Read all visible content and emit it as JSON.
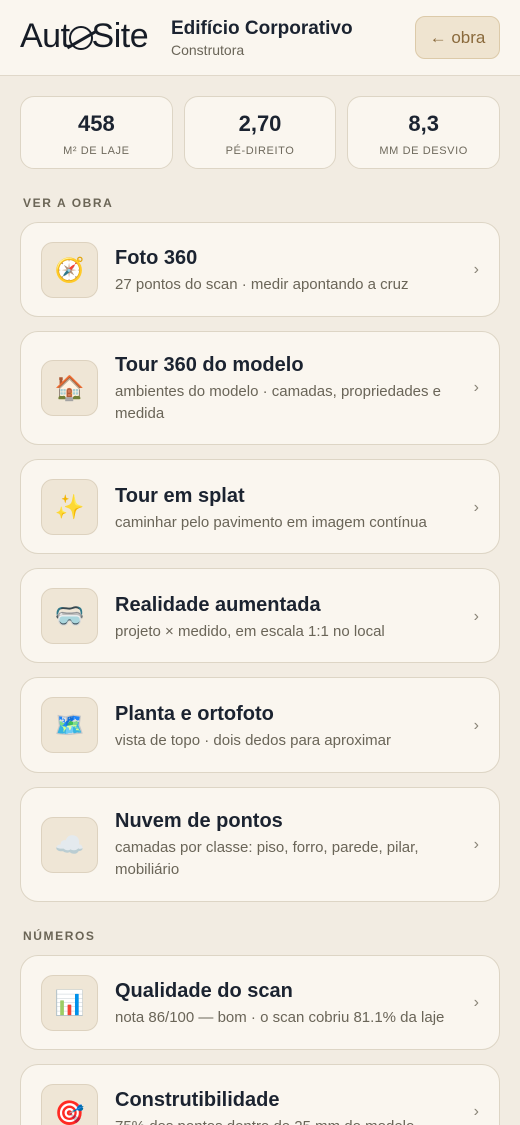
{
  "header": {
    "logo_text_a": "Aut",
    "logo_text_b": "Site",
    "project_title": "Edifício Corporativo",
    "project_subtitle": "Construtora",
    "back_label": "← obra"
  },
  "stats": [
    {
      "value": "458",
      "label": "M² DE LAJE"
    },
    {
      "value": "2,70",
      "label": "PÉ-DIREITO"
    },
    {
      "value": "8,3",
      "label": "MM DE DESVIO"
    }
  ],
  "sections": {
    "view_label": "VER A OBRA",
    "numbers_label": "NÚMEROS"
  },
  "view_cards": [
    {
      "icon": "compass-icon",
      "glyph": "🧭",
      "title": "Foto 360",
      "desc": "27 pontos do scan · medir apontando a cruz"
    },
    {
      "icon": "house-icon",
      "glyph": "🏠",
      "title": "Tour 360 do modelo",
      "desc": "ambientes do modelo · camadas, propriedades e medida"
    },
    {
      "icon": "sparkles-icon",
      "glyph": "✨",
      "title": "Tour em splat",
      "desc": "caminhar pelo pavimento em imagem contínua"
    },
    {
      "icon": "goggles-icon",
      "glyph": "🥽",
      "title": "Realidade aumentada",
      "desc": "projeto × medido, em escala 1:1 no local"
    },
    {
      "icon": "world-map-icon",
      "glyph": "🗺️",
      "title": "Planta e ortofoto",
      "desc": "vista de topo · dois dedos para aproximar"
    },
    {
      "icon": "cloud-icon",
      "glyph": "☁️",
      "title": "Nuvem de pontos",
      "desc": "camadas por classe: piso, forro, parede, pilar, mobiliário"
    }
  ],
  "number_cards": [
    {
      "icon": "bar-chart-icon",
      "glyph": "📊",
      "title": "Qualidade do scan",
      "desc": "nota 86/100 — bom · o scan cobriu 81.1% da laje"
    },
    {
      "icon": "target-icon",
      "glyph": "🎯",
      "title": "Construtibilidade",
      "desc": "75% dos pontos dentro de 25 mm do modelo"
    }
  ],
  "chevron": "›"
}
